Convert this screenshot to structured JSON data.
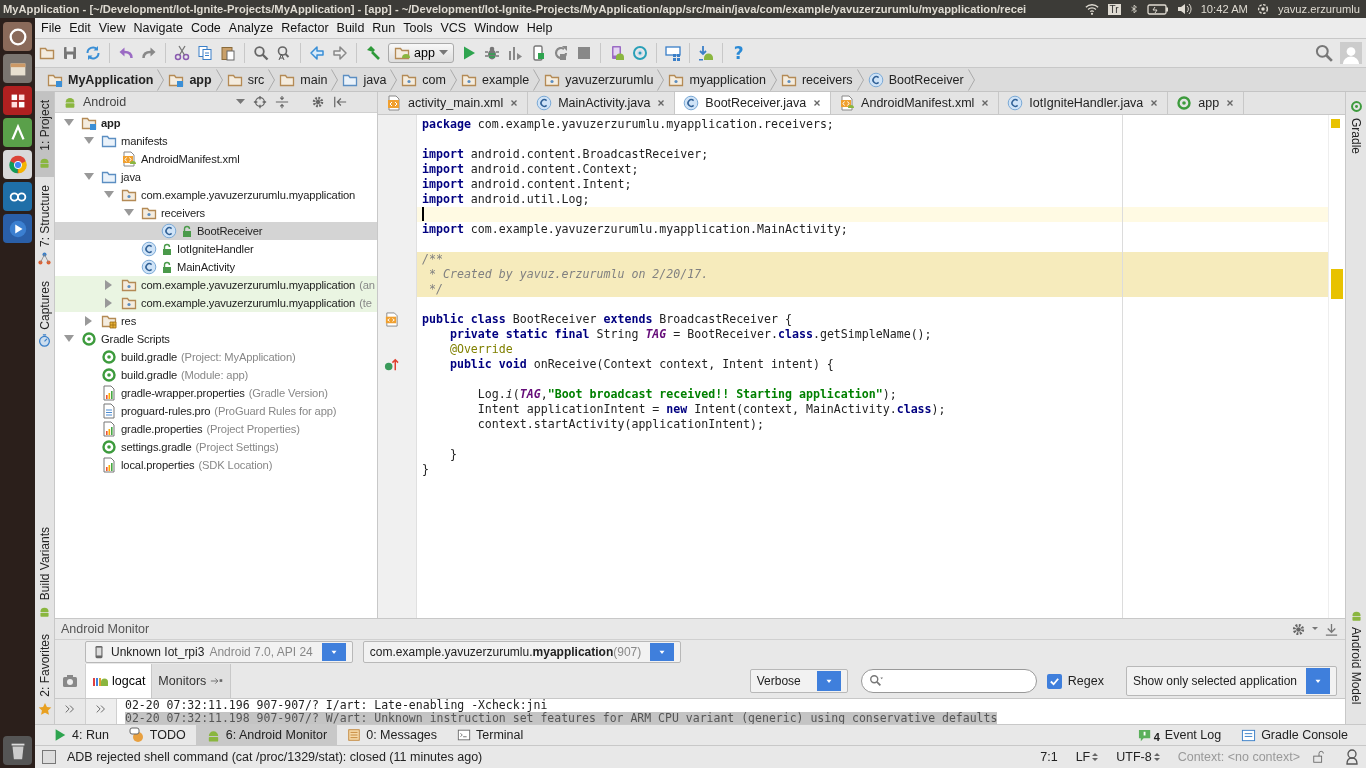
{
  "top_panel": {
    "title": "MyApplication - [~/Development/Iot-Ignite-Projects/MyApplication] - [app] - ~/Development/Iot-Ignite-Projects/MyApplication/app/src/main/java/com/example/yavuzerzurumlu/myapplication/recei",
    "keyboard": "Tr",
    "clock": "10:42 AM",
    "user": "yavuz.erzurumlu"
  },
  "menu": [
    "File",
    "Edit",
    "View",
    "Navigate",
    "Code",
    "Analyze",
    "Refactor",
    "Build",
    "Run",
    "Tools",
    "VCS",
    "Window",
    "Help"
  ],
  "toolbar": {
    "run_config": "app",
    "help": "?"
  },
  "breadcrumbs": [
    {
      "label": "MyApplication",
      "kind": "module",
      "emphasized": true
    },
    {
      "label": "app",
      "kind": "module",
      "emphasized": true
    },
    {
      "label": "src",
      "kind": "folder",
      "emphasized": false
    },
    {
      "label": "main",
      "kind": "folder",
      "emphasized": false
    },
    {
      "label": "java",
      "kind": "source_folder",
      "emphasized": false
    },
    {
      "label": "com",
      "kind": "package",
      "emphasized": false
    },
    {
      "label": "example",
      "kind": "package",
      "emphasized": false
    },
    {
      "label": "yavuzerzurumlu",
      "kind": "package",
      "emphasized": false
    },
    {
      "label": "myapplication",
      "kind": "package",
      "emphasized": false
    },
    {
      "label": "receivers",
      "kind": "package",
      "emphasized": false
    },
    {
      "label": "BootReceiver",
      "kind": "class",
      "emphasized": false
    }
  ],
  "left_tool_strip": [
    {
      "label": "1: Project",
      "selected": true
    },
    {
      "label": "7: Structure",
      "selected": false
    },
    {
      "label": "Captures",
      "selected": false
    },
    {
      "label": "Build Variants",
      "selected": false
    },
    {
      "label": "2: Favorites",
      "selected": false
    }
  ],
  "right_tool_strip": [
    {
      "label": "Gradle",
      "selected": false
    },
    {
      "label": "Android Model",
      "selected": false
    }
  ],
  "project_panel": {
    "view": "Android",
    "tree": [
      {
        "label": "app",
        "kind": "module",
        "expanded": true,
        "selected": false,
        "children": [
          {
            "label": "manifests",
            "kind": "source_folder",
            "expanded": true,
            "selected": false,
            "children": [
              {
                "label": "AndroidManifest.xml",
                "kind": "manifest",
                "selected": false
              }
            ]
          },
          {
            "label": "java",
            "kind": "source_folder",
            "expanded": true,
            "selected": false,
            "children": [
              {
                "label": "com.example.yavuzerzurumlu.myapplication",
                "kind": "package",
                "expanded": true,
                "selected": false,
                "children": [
                  {
                    "label": "receivers",
                    "kind": "package",
                    "expanded": true,
                    "selected": false,
                    "children": [
                      {
                        "label": "BootReceiver",
                        "kind": "class",
                        "selected": true
                      }
                    ]
                  },
                  {
                    "label": "IotIgniteHandler",
                    "kind": "class",
                    "selected": false
                  },
                  {
                    "label": "MainActivity",
                    "kind": "class",
                    "selected": false
                  }
                ]
              },
              {
                "label": "com.example.yavuzerzurumlu.myapplication",
                "hint": "(an",
                "kind": "test_package",
                "expanded": false,
                "selected": false
              },
              {
                "label": "com.example.yavuzerzurumlu.myapplication",
                "hint": "(te",
                "kind": "test_package",
                "expanded": false,
                "selected": false
              }
            ]
          },
          {
            "label": "res",
            "kind": "res_folder",
            "expanded": false,
            "selected": false
          }
        ]
      },
      {
        "label": "Gradle Scripts",
        "kind": "gradle",
        "expanded": true,
        "selected": false,
        "children": [
          {
            "label": "build.gradle",
            "hint": "(Project: MyApplication)",
            "kind": "gradle",
            "selected": false
          },
          {
            "label": "build.gradle",
            "hint": "(Module: app)",
            "kind": "gradle",
            "selected": false
          },
          {
            "label": "gradle-wrapper.properties",
            "hint": "(Gradle Version)",
            "kind": "properties",
            "selected": false
          },
          {
            "label": "proguard-rules.pro",
            "hint": "(ProGuard Rules for app)",
            "kind": "text",
            "selected": false
          },
          {
            "label": "gradle.properties",
            "hint": "(Project Properties)",
            "kind": "properties",
            "selected": false
          },
          {
            "label": "settings.gradle",
            "hint": "(Project Settings)",
            "kind": "gradle",
            "selected": false
          },
          {
            "label": "local.properties",
            "hint": "(SDK Location)",
            "kind": "properties",
            "selected": false
          }
        ]
      }
    ]
  },
  "editor": {
    "tabs": [
      {
        "label": "activity_main.xml",
        "kind": "layout",
        "selected": false
      },
      {
        "label": "MainActivity.java",
        "kind": "class",
        "selected": false
      },
      {
        "label": "BootReceiver.java",
        "kind": "class",
        "selected": true
      },
      {
        "label": "AndroidManifest.xml",
        "kind": "manifest",
        "selected": false
      },
      {
        "label": "IotIgniteHandler.java",
        "kind": "class",
        "selected": false
      },
      {
        "label": "app",
        "kind": "gradle",
        "selected": false
      }
    ],
    "lines": [
      {
        "kind": "code",
        "current": false,
        "highlighted": false,
        "tokens": [
          {
            "kind": "keyword",
            "text": "package"
          },
          {
            "kind": "plain",
            "text": " com.example.yavuzerzurumlu.myapplication.receivers;"
          }
        ]
      },
      {
        "kind": "code",
        "current": false,
        "highlighted": false
      },
      {
        "kind": "code",
        "current": false,
        "highlighted": false,
        "tokens": [
          {
            "kind": "keyword",
            "text": "import"
          },
          {
            "kind": "plain",
            "text": " android.content.BroadcastReceiver;"
          }
        ]
      },
      {
        "kind": "code",
        "current": false,
        "highlighted": false,
        "tokens": [
          {
            "kind": "keyword",
            "text": "import"
          },
          {
            "kind": "plain",
            "text": " android.content.Context;"
          }
        ]
      },
      {
        "kind": "code",
        "current": false,
        "highlighted": false,
        "tokens": [
          {
            "kind": "keyword",
            "text": "import"
          },
          {
            "kind": "plain",
            "text": " android.content.Intent;"
          }
        ]
      },
      {
        "kind": "code",
        "current": false,
        "highlighted": false,
        "tokens": [
          {
            "kind": "keyword",
            "text": "import"
          },
          {
            "kind": "plain",
            "text": " android.util.Log;"
          }
        ]
      },
      {
        "kind": "code",
        "current": true,
        "highlighted": false
      },
      {
        "kind": "code",
        "current": false,
        "highlighted": false,
        "tokens": [
          {
            "kind": "keyword",
            "text": "import"
          },
          {
            "kind": "plain",
            "text": " com.example.yavuzerzurumlu.myapplication.MainActivity;"
          }
        ]
      },
      {
        "kind": "code",
        "current": false,
        "highlighted": false
      },
      {
        "kind": "code",
        "current": false,
        "highlighted": true,
        "tokens": [
          {
            "kind": "comment",
            "text": "/**"
          }
        ]
      },
      {
        "kind": "code",
        "current": false,
        "highlighted": true,
        "tokens": [
          {
            "kind": "comment",
            "text": " * Created by yavuz.erzurumlu on 2/20/17."
          }
        ]
      },
      {
        "kind": "code",
        "current": false,
        "highlighted": true,
        "tokens": [
          {
            "kind": "comment",
            "text": " */"
          }
        ]
      },
      {
        "kind": "code",
        "current": false,
        "highlighted": false
      },
      {
        "kind": "layout_marker",
        "current": false,
        "highlighted": false,
        "tokens": [
          {
            "kind": "keyword",
            "text": "public class"
          },
          {
            "kind": "plain",
            "text": " BootReceiver "
          },
          {
            "kind": "keyword",
            "text": "extends"
          },
          {
            "kind": "plain",
            "text": " BroadcastReceiver {"
          }
        ]
      },
      {
        "kind": "code",
        "current": false,
        "highlighted": false,
        "tokens": [
          {
            "kind": "keyword",
            "text": "    private static final"
          },
          {
            "kind": "plain",
            "text": " String "
          },
          {
            "kind": "constant",
            "text": "TAG"
          },
          {
            "kind": "plain",
            "text": " = BootReceiver."
          },
          {
            "kind": "keyword",
            "text": "class"
          },
          {
            "kind": "plain",
            "text": ".getSimpleName();"
          }
        ]
      },
      {
        "kind": "code",
        "current": false,
        "highlighted": false,
        "tokens": [
          {
            "kind": "annotation",
            "text": "    @Override"
          }
        ]
      },
      {
        "kind": "override_marker",
        "current": false,
        "highlighted": false,
        "tokens": [
          {
            "kind": "keyword",
            "text": "    public void"
          },
          {
            "kind": "plain",
            "text": " onReceive(Context context, Intent intent) {"
          }
        ]
      },
      {
        "kind": "code",
        "current": false,
        "highlighted": false
      },
      {
        "kind": "code",
        "current": false,
        "highlighted": false,
        "tokens": [
          {
            "kind": "plain",
            "text": "        Log."
          },
          {
            "kind": "static_call",
            "text": "i"
          },
          {
            "kind": "plain",
            "text": "("
          },
          {
            "kind": "constant",
            "text": "TAG"
          },
          {
            "kind": "plain",
            "text": ","
          },
          {
            "kind": "string",
            "text": "\"Boot broadcast received!! Starting application\""
          },
          {
            "kind": "plain",
            "text": ");"
          }
        ]
      },
      {
        "kind": "code",
        "current": false,
        "highlighted": false,
        "tokens": [
          {
            "kind": "plain",
            "text": "        Intent applicationIntent = "
          },
          {
            "kind": "keyword",
            "text": "new"
          },
          {
            "kind": "plain",
            "text": " Intent(context, MainActivity."
          },
          {
            "kind": "keyword",
            "text": "class"
          },
          {
            "kind": "plain",
            "text": ");"
          }
        ]
      },
      {
        "kind": "code",
        "current": false,
        "highlighted": false,
        "tokens": [
          {
            "kind": "plain",
            "text": "        context.startActivity(applicationIntent);"
          }
        ]
      },
      {
        "kind": "code",
        "current": false,
        "highlighted": false
      },
      {
        "kind": "code",
        "current": false,
        "highlighted": false,
        "tokens": [
          {
            "kind": "plain",
            "text": "    }"
          }
        ]
      },
      {
        "kind": "code",
        "current": false,
        "highlighted": false,
        "tokens": [
          {
            "kind": "plain",
            "text": "}"
          }
        ]
      }
    ]
  },
  "android_monitor": {
    "title": "Android Monitor",
    "device": "Unknown Iot_rpi3",
    "device_detail": "Android 7.0, API 24",
    "process": "com.example.yavuzerzurumlu.**myapplication**(907)",
    "tabs": [
      {
        "label": "logcat",
        "selected": true
      },
      {
        "label": "Monitors",
        "selected": false
      }
    ],
    "log_level": "Verbose",
    "regex": {
      "label": "Regex",
      "checked": true
    },
    "filter": "Show only selected application",
    "log": [
      {
        "text": "02-20 07:32:11.196 907-907/? I/art: Late-enabling -Xcheck:jni",
        "selected": false
      },
      {
        "text": "02-20 07:32:11.198 907-907/? W/art: Unknown instruction set features for ARM CPU variant (generic) using conservative defaults",
        "selected": true
      }
    ]
  },
  "tool_tabs": {
    "left": [
      {
        "label": "4: Run",
        "selected": false
      },
      {
        "label": "TODO",
        "selected": false
      },
      {
        "label": "6: Android Monitor",
        "selected": true
      },
      {
        "label": "0: Messages",
        "selected": false
      },
      {
        "label": "Terminal",
        "selected": false
      }
    ],
    "right": [
      {
        "label": "Event Log",
        "badge": "4"
      },
      {
        "label": "Gradle Console"
      }
    ]
  },
  "status_bar": {
    "message": "ADB rejected shell command (cat /proc/1329/stat): closed (11 minutes ago)",
    "position": "7:1",
    "line_separator": "LF",
    "encoding": "UTF-8",
    "context": "Context: <no context>"
  }
}
